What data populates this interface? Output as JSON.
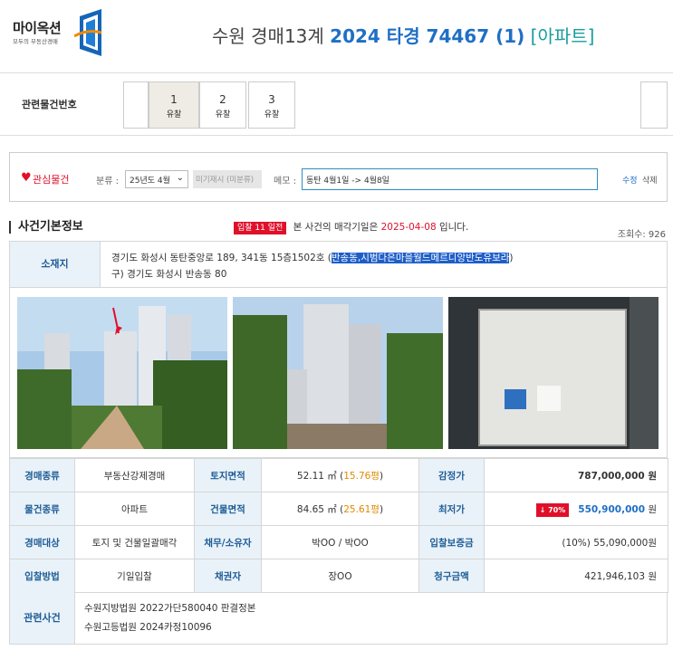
{
  "logo": {
    "name": "마이옥션",
    "tagline": "모두의 부동산경매"
  },
  "title": {
    "court": "수원 경매13계",
    "case_no": "2024 타경 74467 (1)",
    "kind": "[아파트]"
  },
  "related": {
    "label": "관련물건번호",
    "items": [
      {
        "num": "1",
        "status": "유찰",
        "active": true
      },
      {
        "num": "2",
        "status": "유찰",
        "active": false
      },
      {
        "num": "3",
        "status": "유찰",
        "active": false
      }
    ]
  },
  "interest": {
    "label": "관심물건",
    "category_label": "분류 :",
    "category_value": "25년도 4월",
    "unclassified": "미기재시 (미분류)",
    "memo_label": "메모 :",
    "memo_value": "동탄 4월1일 -> 4월8일",
    "edit": "수정",
    "delete": "삭제"
  },
  "section": {
    "title": "사건기본정보",
    "badge": "입찰 11 일전",
    "notice_pre": "본 사건의 매각기일은",
    "notice_date": "2025-04-08",
    "notice_post": "입니다.",
    "views": "조회수: 926"
  },
  "location": {
    "label": "소재지",
    "addr_main": "경기도 화성시 동탄중앙로 189, 341동 15층1502호 (",
    "addr_highlight": "반송동,시범다은마을월드메르디앙반도유보라",
    "addr_close": ")",
    "addr_old": "구) 경기도 화성시 반송동 80"
  },
  "details": {
    "auction_type_label": "경매종류",
    "auction_type": "부동산강제경매",
    "land_area_label": "토지면적",
    "land_area": "52.11 ㎡ (",
    "land_area_py": "15.76평",
    "land_area_close": ")",
    "appraisal_label": "감정가",
    "appraisal": "787,000,000 원",
    "prop_type_label": "물건종류",
    "prop_type": "아파트",
    "bld_area_label": "건물면적",
    "bld_area": "84.65 ㎡ (",
    "bld_area_py": "25.61평",
    "bld_area_close": ")",
    "min_price_label": "최저가",
    "min_pct": "↓ 70%",
    "min_price": "550,900,000",
    "won": " 원",
    "target_label": "경매대상",
    "target": "토지 및 건물일괄매각",
    "debtor_label": "채무/소유자",
    "debtor": "박OO / 박OO",
    "deposit_label": "입찰보증금",
    "deposit": "(10%) 55,090,000원",
    "method_label": "입찰방법",
    "method": "기일입찰",
    "creditor_label": "채권자",
    "creditor": "장OO",
    "claim_label": "청구금액",
    "claim": "421,946,103 원"
  },
  "related_case": {
    "label": "관련사건",
    "line1": "수원지방법원 2022가단580040 판결정본",
    "line2": "수원고등법원 2024카정10096"
  },
  "colors": {
    "accent_blue": "#1f6fc5",
    "alert_red": "#e0102a",
    "header_bg": "#e9f2f9"
  }
}
